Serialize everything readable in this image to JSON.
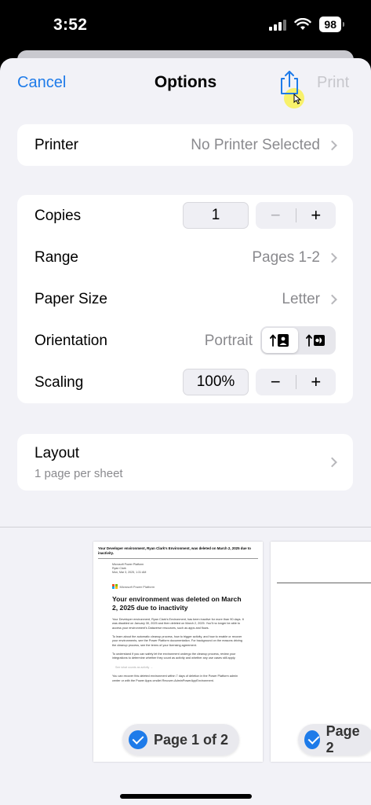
{
  "status_bar": {
    "time": "3:52",
    "battery": "98",
    "icons": [
      "signal-icon",
      "wifi-icon",
      "battery-icon"
    ]
  },
  "nav": {
    "cancel": "Cancel",
    "title": "Options",
    "share_icon": "share-icon",
    "print": "Print"
  },
  "printer": {
    "label": "Printer",
    "value": "No Printer Selected"
  },
  "copies": {
    "label": "Copies",
    "value": "1",
    "minus": "−",
    "plus": "+"
  },
  "range": {
    "label": "Range",
    "value": "Pages 1-2"
  },
  "paper_size": {
    "label": "Paper Size",
    "value": "Letter"
  },
  "orientation": {
    "label": "Orientation",
    "value": "Portrait",
    "selected": "portrait"
  },
  "scaling": {
    "label": "Scaling",
    "value": "100%",
    "minus": "−",
    "plus": "+"
  },
  "layout": {
    "label": "Layout",
    "value": "1 page per sheet"
  },
  "preview": {
    "page1": {
      "header": "Your Developer environment, Ryan Clark's Environment, was deleted on March 2, 2025 due to inactivity.",
      "meta": [
        "Microsoft Power Platform",
        "Ryan Clark",
        "Mon, Mar 3, 2025, 1:31 AM"
      ],
      "brand": "Microsoft Power Platform",
      "title": "Your environment was deleted on March 2, 2025 due to inactivity",
      "paragraphs": [
        "Your Developer environment, Ryan Clark's Environment, has been inactive for more than 90 days. It was disabled on January 30, 2025 and then deleted on March 2, 2025. You'll no longer be able to access your environment's Dataverse resources, such as apps and flows.",
        "To learn about the automatic cleanup process, how to trigger activity, and how to enable or recover your environments, see the Power Platform documentation. For background on the reasons driving the cleanup process, see the terms of your licensing agreement.",
        "To understand if you can safely let the environment undergo the cleanup process, review your integrations to determine whether they count as activity and whether any use cases still apply."
      ],
      "link_text": "See what counts as activity →",
      "recover_text": "You can recover this deleted environment within 7 days of deletion in the Power Platform admin center or with the Power Apps cmdlet Recover-AdminPowerAppEnvironment.",
      "label": "Page 1 of 2"
    },
    "page2": {
      "label": "Page 2"
    }
  },
  "colors": {
    "accent": "#1e7be9",
    "background": "#f2f2f7",
    "disabled": "#c7c7cc",
    "secondary_text": "#8a8a8e"
  }
}
